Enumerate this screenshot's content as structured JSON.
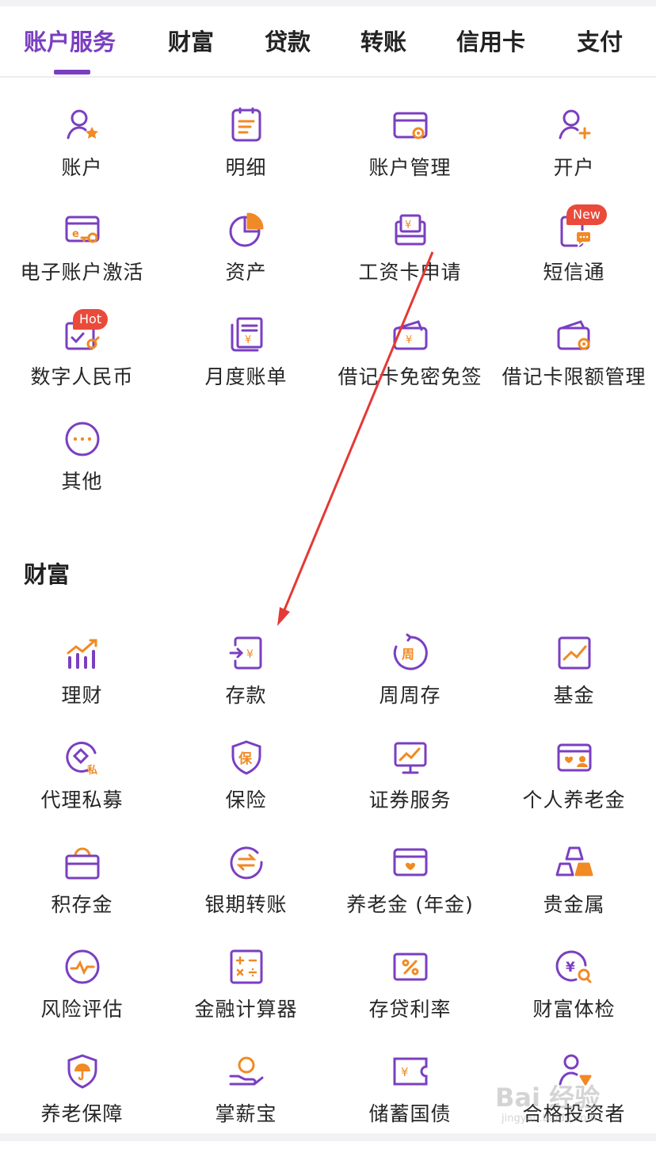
{
  "tabs": [
    "账户服务",
    "财富",
    "贷款",
    "转账",
    "信用卡",
    "支付"
  ],
  "account": {
    "items": [
      {
        "label": "账户",
        "icon": "user-star-icon"
      },
      {
        "label": "明细",
        "icon": "list-doc-icon"
      },
      {
        "label": "账户管理",
        "icon": "card-gear-icon"
      },
      {
        "label": "开户",
        "icon": "user-plus-icon"
      },
      {
        "label": "电子账户激活",
        "icon": "ecard-key-icon"
      },
      {
        "label": "资产",
        "icon": "pie-chart-icon"
      },
      {
        "label": "工资卡申请",
        "icon": "salary-card-icon"
      },
      {
        "label": "短信通",
        "icon": "phone-message-icon",
        "badge": "New"
      },
      {
        "label": "数字人民币",
        "icon": "digital-rmb-icon",
        "badge": "Hot"
      },
      {
        "label": "月度账单",
        "icon": "monthly-bill-icon"
      },
      {
        "label": "借记卡免密免签",
        "icon": "debit-card-icon"
      },
      {
        "label": "借记卡限额管理",
        "icon": "wallet-gear-icon"
      },
      {
        "label": "其他",
        "icon": "more-dots-icon"
      }
    ]
  },
  "wealth": {
    "title": "财富",
    "items": [
      {
        "label": "理财",
        "icon": "bar-trend-icon"
      },
      {
        "label": "存款",
        "icon": "deposit-icon"
      },
      {
        "label": "周周存",
        "icon": "weekly-icon"
      },
      {
        "label": "基金",
        "icon": "fund-chart-icon"
      },
      {
        "label": "代理私募",
        "icon": "private-fund-icon"
      },
      {
        "label": "保险",
        "icon": "insurance-shield-icon"
      },
      {
        "label": "证券服务",
        "icon": "securities-monitor-icon"
      },
      {
        "label": "个人养老金",
        "icon": "pension-card-icon"
      },
      {
        "label": "积存金",
        "icon": "gold-bag-icon"
      },
      {
        "label": "银期转账",
        "icon": "exchange-icon"
      },
      {
        "label": "养老金 (年金)",
        "icon": "annuity-card-icon"
      },
      {
        "label": "贵金属",
        "icon": "gold-bars-icon"
      },
      {
        "label": "风险评估",
        "icon": "risk-pulse-icon"
      },
      {
        "label": "金融计算器",
        "icon": "calculator-icon"
      },
      {
        "label": "存贷利率",
        "icon": "percent-card-icon"
      },
      {
        "label": "财富体检",
        "icon": "wealth-check-icon"
      },
      {
        "label": "养老保障",
        "icon": "umbrella-shield-icon"
      },
      {
        "label": "掌薪宝",
        "icon": "hand-coin-icon"
      },
      {
        "label": "储蓄国债",
        "icon": "bond-ticket-icon"
      },
      {
        "label": "合格投资者",
        "icon": "qualified-investor-icon"
      }
    ]
  },
  "colors": {
    "accent": "#7a3fc1",
    "secondary": "#f08a24",
    "badge": "#ea4a3a",
    "annotation": "#e53935"
  },
  "watermark": {
    "text": "Bai 经验",
    "sub": "jingyan.baidu.com"
  }
}
